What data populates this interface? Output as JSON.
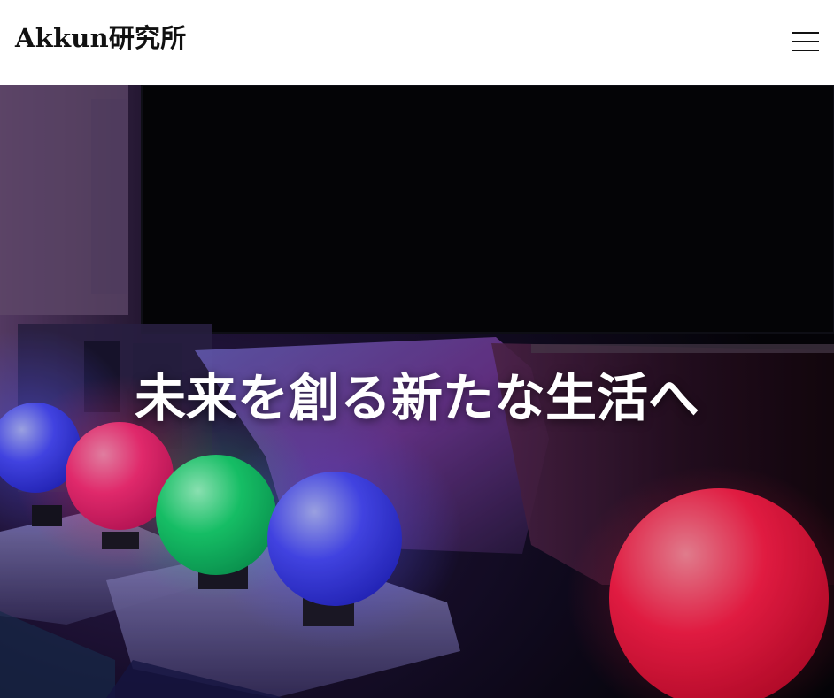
{
  "header": {
    "site_title": "Akkun研究所",
    "menu_icon": "hamburger-menu-icon"
  },
  "hero": {
    "heading": "未来を創る新たな生活へ",
    "image_description_icon": "hero-photo",
    "colors": {
      "blue_orb": "#4a4cff",
      "pink_orb": "#ff2f7a",
      "green_orb": "#19d873",
      "red_orb": "#ff1f4a",
      "background": "#07050e"
    }
  }
}
